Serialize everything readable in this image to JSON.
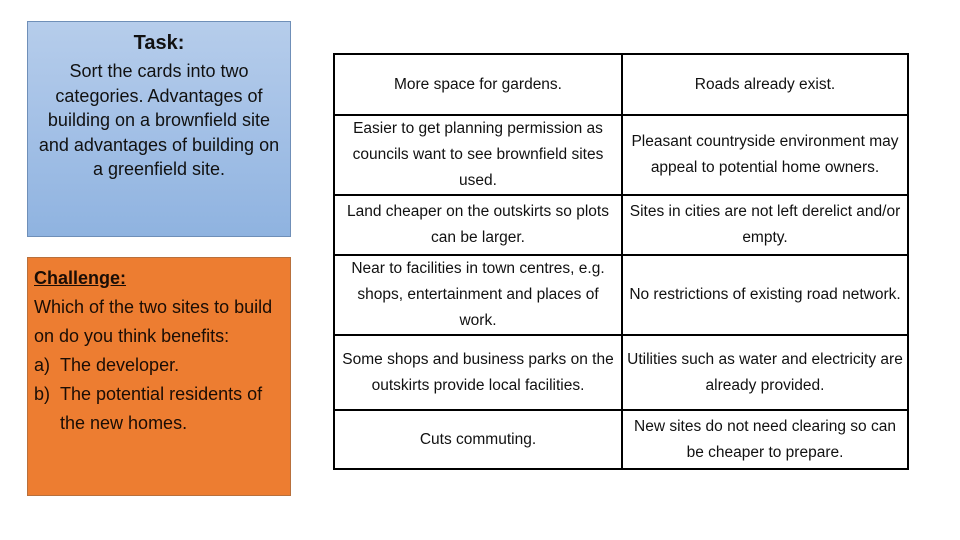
{
  "task": {
    "title": "Task:",
    "body": "Sort the cards into two categories. Advantages of building on a brownfield site and advantages of building on a greenfield site.",
    "background_color": "#a3c0e6"
  },
  "challenge": {
    "title": "Challenge:",
    "question": "Which of the two sites to build on do you think benefits:",
    "options": [
      {
        "marker": "a)",
        "text": "The developer."
      },
      {
        "marker": "b)",
        "text": "The potential residents of the new homes."
      }
    ],
    "background_color": "#ed7d31"
  },
  "cards": {
    "rows": [
      [
        "More space for gardens.",
        "Roads already exist."
      ],
      [
        "Easier to get planning permission as councils want to see brownfield sites used.",
        "Pleasant countryside environment may appeal to potential home owners."
      ],
      [
        "Land cheaper on the outskirts so plots can be larger.",
        "Sites in cities are not left derelict and/or empty."
      ],
      [
        "Near to facilities in town centres, e.g. shops, entertainment and places of work.",
        "No restrictions of existing road network."
      ],
      [
        "Some shops and business parks on the outskirts provide local facilities.",
        "Utilities such as water and electricity are already provided."
      ],
      [
        "Cuts commuting.",
        "New sites do not need clearing so can be cheaper to prepare."
      ]
    ]
  }
}
